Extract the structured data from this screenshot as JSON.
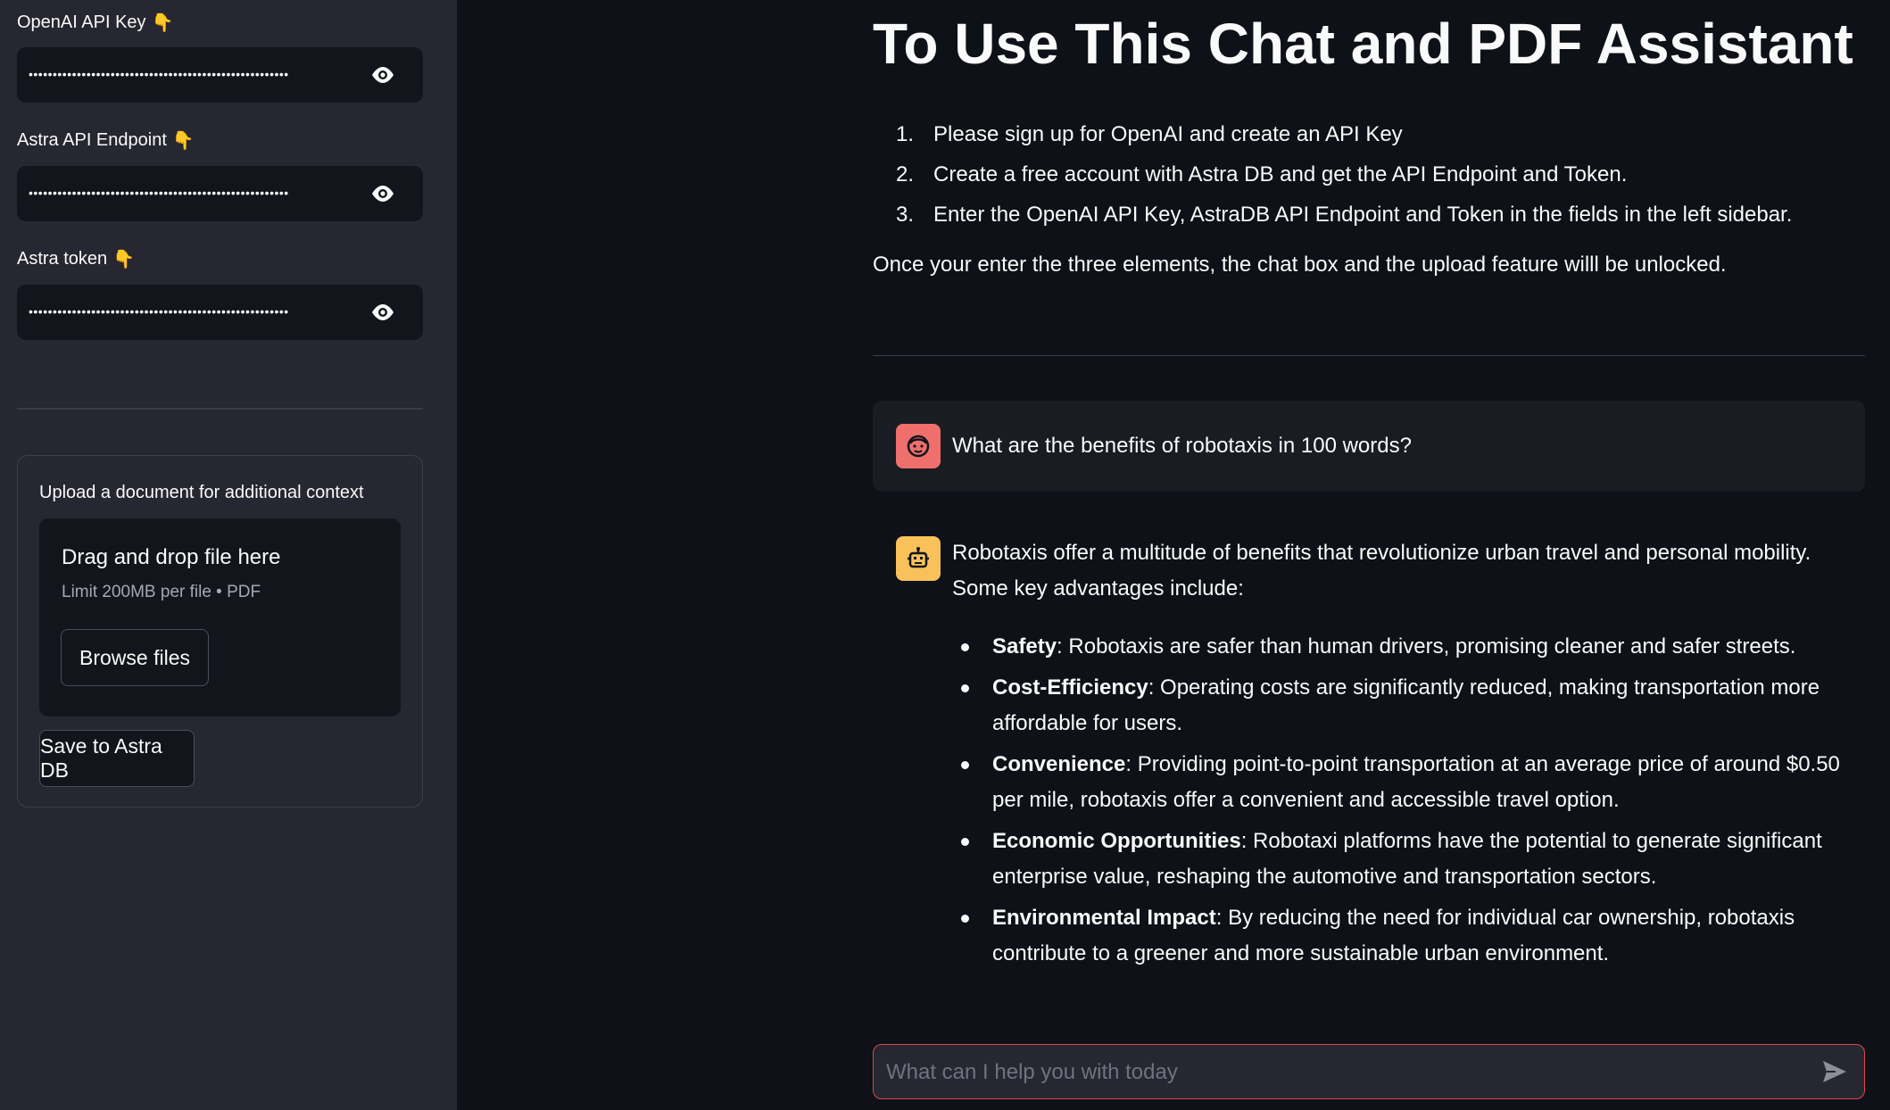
{
  "sidebar": {
    "fields": [
      {
        "label": "OpenAI API Key",
        "emoji": "👇",
        "masked": "••••••••••••••••••••••••••••••••••••••••••••••••••••••"
      },
      {
        "label": "Astra API Endpoint",
        "emoji": "👇",
        "masked": "••••••••••••••••••••••••••••••••••••••••••••••••••••••"
      },
      {
        "label": "Astra token",
        "emoji": "👇",
        "masked": "••••••••••••••••••••••••••••••••••••••••••••••••••••••"
      }
    ],
    "upload": {
      "title": "Upload a document for additional context",
      "drop_text": "Drag and drop file here",
      "limit_text": "Limit 200MB per file • PDF",
      "browse_label": "Browse files",
      "save_label": "Save to Astra DB"
    }
  },
  "main": {
    "title": "To Use This Chat and PDF Assistant",
    "steps": [
      {
        "num": "1.",
        "text": "Please sign up for OpenAI and create an API Key"
      },
      {
        "num": "2.",
        "text": "Create a free account with Astra DB and get the API Endpoint and Token."
      },
      {
        "num": "3.",
        "text": "Enter the OpenAI API Key, AstraDB API Endpoint and Token in the fields in the left sidebar."
      }
    ],
    "note": "Once your enter the three elements, the chat box and the upload feature willl be unlocked.",
    "user_message": "What are the benefits of robotaxis in 100 words?",
    "assistant": {
      "intro": "Robotaxis offer a multitude of benefits that revolutionize urban travel and personal mobility. Some key advantages include:",
      "points": [
        {
          "term": "Safety",
          "text": ": Robotaxis are safer than human drivers, promising cleaner and safer streets."
        },
        {
          "term": "Cost-Efficiency",
          "text": ": Operating costs are significantly reduced, making transportation more affordable for users."
        },
        {
          "term": "Convenience",
          "text": ": Providing point-to-point transportation at an average price of around $0.50 per mile, robotaxis offer a convenient and accessible travel option."
        },
        {
          "term": "Economic Opportunities",
          "text": ": Robotaxi platforms have the potential to generate significant enterprise value, reshaping the automotive and transportation sectors."
        },
        {
          "term": "Environmental Impact",
          "text": ": By reducing the need for individual car ownership, robotaxis contribute to a greener and more sustainable urban environment."
        }
      ]
    },
    "chat_input": {
      "placeholder": "What can I help you with today"
    }
  },
  "colors": {
    "background": "#0e1117",
    "sidebar": "#262730",
    "user_avatar": "#ef6f6c",
    "bot_avatar": "#f8c15a",
    "input_border": "#e0444c"
  },
  "icons": {
    "field_toggle": "eye-icon",
    "user_avatar": "user-face-icon",
    "bot_avatar": "robot-icon",
    "send": "send-arrow-icon"
  }
}
